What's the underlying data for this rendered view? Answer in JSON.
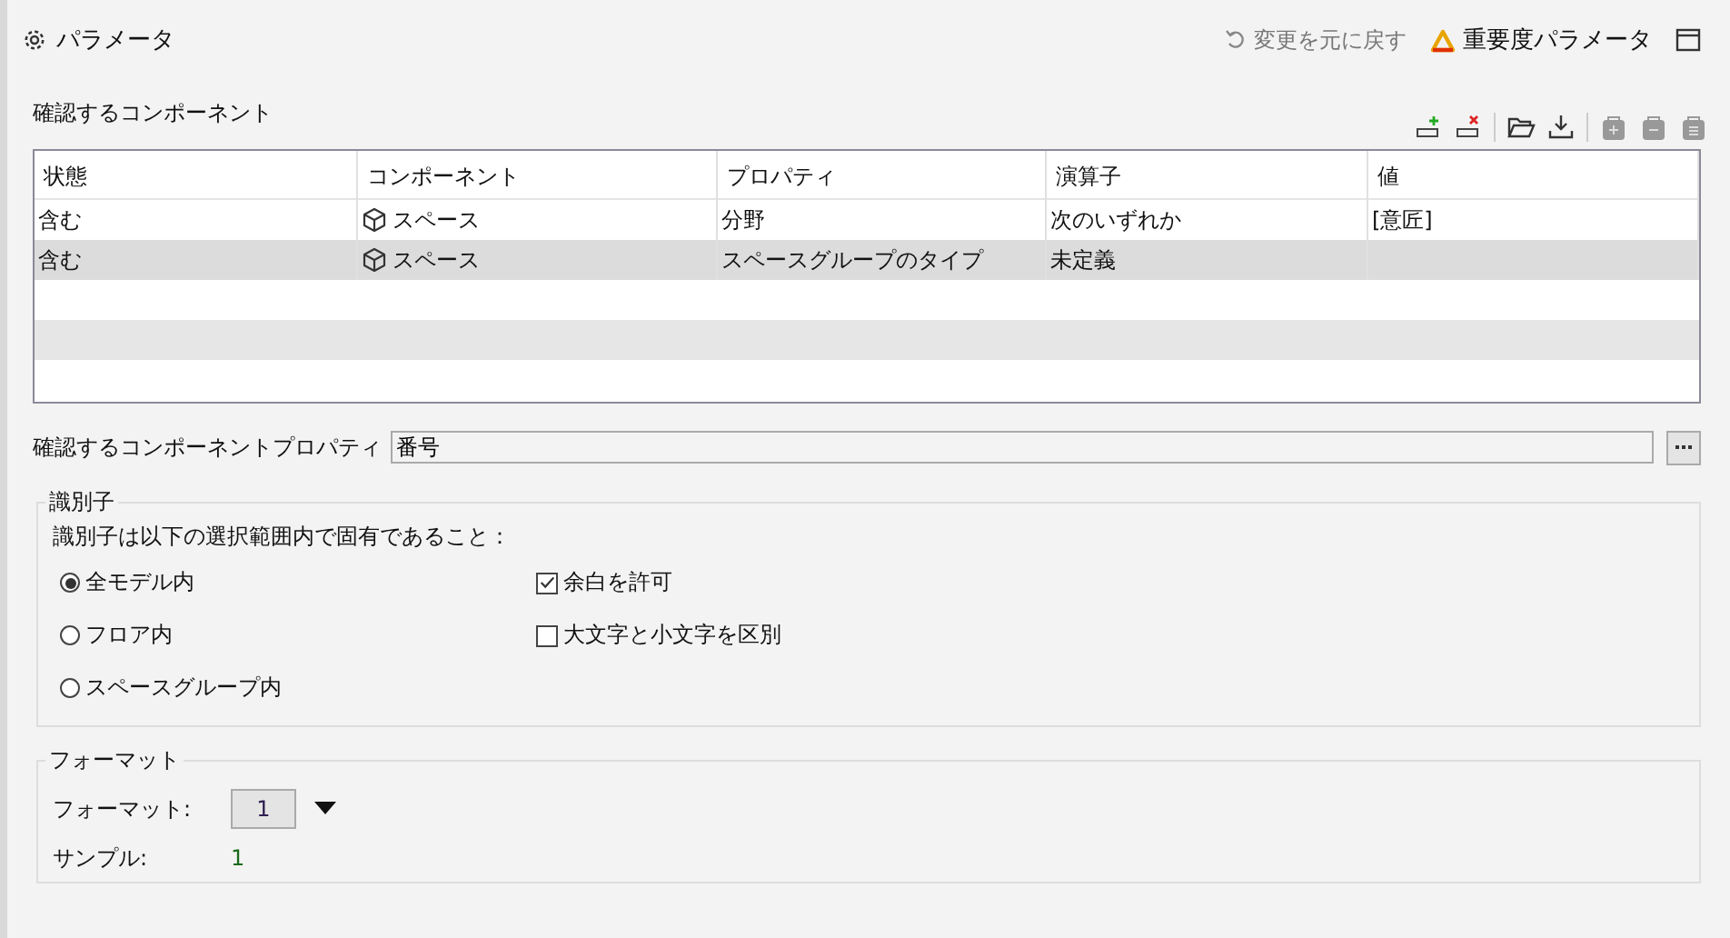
{
  "header": {
    "title": "パラメータ",
    "undo": "変更を元に戻す",
    "importance": "重要度パラメータ"
  },
  "components_section": {
    "title": "確認するコンポーネント"
  },
  "table": {
    "columns": [
      "状態",
      "コンポーネント",
      "プロパティ",
      "演算子",
      "値"
    ],
    "rows": [
      {
        "selected": false,
        "cells": [
          "含む",
          "スペース",
          "分野",
          "次のいずれか",
          "[意匠]"
        ]
      },
      {
        "selected": true,
        "cells": [
          "含む",
          "スペース",
          "スペースグループのタイプ",
          "未定義",
          ""
        ]
      }
    ]
  },
  "property_field": {
    "label": "確認するコンポーネントプロパティ",
    "value": "番号"
  },
  "identifier": {
    "title": "識別子",
    "description": "識別子は以下の選択範囲内で固有であること：",
    "scopes": [
      {
        "label": "全モデル内",
        "selected": true
      },
      {
        "label": "フロア内",
        "selected": false
      },
      {
        "label": "スペースグループ内",
        "selected": false
      }
    ],
    "options": [
      {
        "label": "余白を許可",
        "checked": true
      },
      {
        "label": "大文字と小文字を区別",
        "checked": false
      }
    ]
  },
  "format": {
    "title": "フォーマット",
    "label": "フォーマット:",
    "value": "1",
    "sample_label": "サンプル:",
    "sample": "1"
  }
}
